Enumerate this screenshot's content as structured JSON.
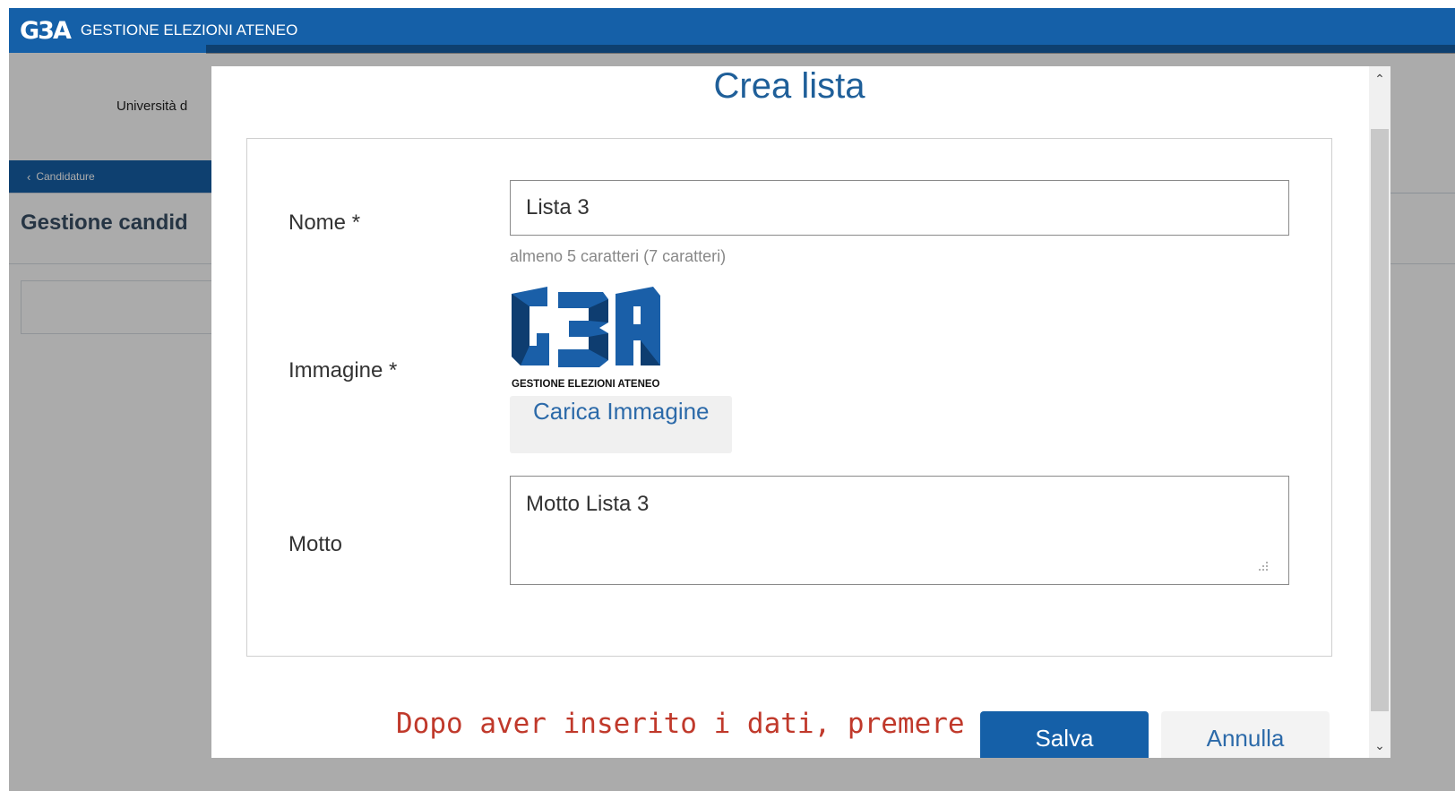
{
  "app": {
    "logo_text": "G3A",
    "title": "GESTIONE ELEZIONI ATENEO",
    "university_text": "Università d",
    "nav_back_label": "Candidature",
    "page_heading": "Gestione candid"
  },
  "modal": {
    "title": "Crea lista",
    "fields": {
      "nome_label": "Nome *",
      "nome_value": "Lista 3",
      "nome_hint": "almeno 5 caratteri (7 caratteri)",
      "immagine_label": "Immagine *",
      "logo_caption": "GESTIONE ELEZIONI ATENEO",
      "upload_label": "Carica Immagine",
      "motto_label": "Motto",
      "motto_value": "Motto Lista 3"
    },
    "footer_note": "Dopo aver inserito i dati, premere Salva",
    "save_label": "Salva",
    "cancel_label": "Annulla"
  },
  "colors": {
    "brand_blue": "#1560a8",
    "title_blue": "#1f5f99",
    "note_red": "#c0392b"
  },
  "icons": {
    "back": "chevron-left-icon",
    "scroll_up": "chevron-up-icon",
    "scroll_down": "chevron-down-icon",
    "resize": "resize-grip-icon"
  }
}
